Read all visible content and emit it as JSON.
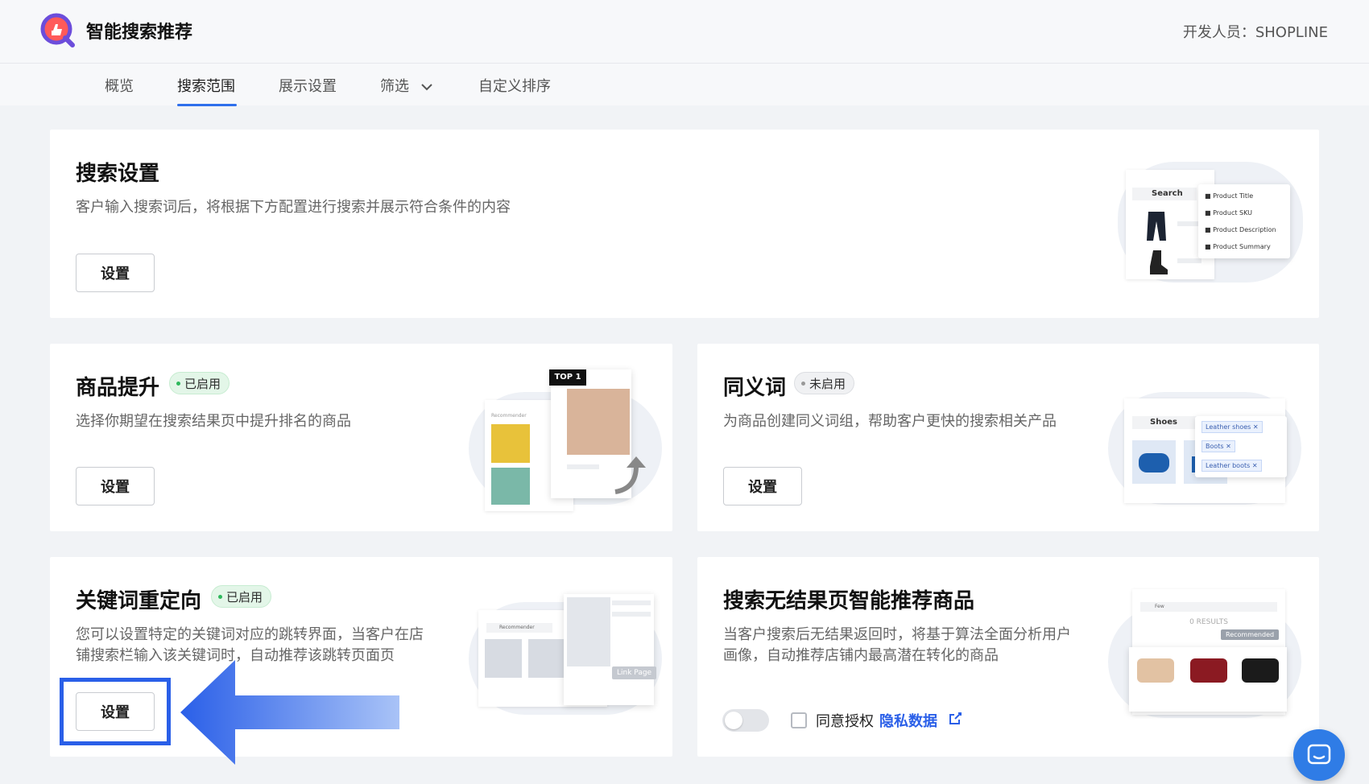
{
  "header": {
    "app_title": "智能搜索推荐",
    "developer": "开发人员：SHOPLINE"
  },
  "tabs": [
    {
      "label": "概览"
    },
    {
      "label": "搜索范围"
    },
    {
      "label": "展示设置"
    },
    {
      "label": "筛选"
    },
    {
      "label": "自定义排序"
    }
  ],
  "cards": {
    "search_settings": {
      "title": "搜索设置",
      "desc": "客户输入搜索词后，将根据下方配置进行搜索并展示符合条件的内容",
      "button": "设置",
      "illus": {
        "search": "Search",
        "options": [
          "Product Title",
          "Product SKU",
          "Product Description",
          "Product Summary"
        ]
      }
    },
    "product_boost": {
      "title": "商品提升",
      "badge": "已启用",
      "desc": "选择你期望在搜索结果页中提升排名的商品",
      "button": "设置",
      "illus": {
        "top_label": "TOP 1",
        "recommender": "Recommender"
      }
    },
    "synonyms": {
      "title": "同义词",
      "badge": "未启用",
      "desc": "为商品创建同义词组，帮助客户更快的搜索相关产品",
      "button": "设置",
      "illus": {
        "search": "Shoes",
        "tags": [
          "Leather shoes",
          "Boots",
          "Leather boots"
        ]
      }
    },
    "keyword_redirect": {
      "title": "关键词重定向",
      "badge": "已启用",
      "desc_line1": "您可以设置特定的关键词对应的跳转界面，当客户在店",
      "desc_line2": "铺搜索栏输入该关键词时，自动推荐该跳转页面页",
      "button": "设置",
      "illus": {
        "recommender": "Recommender",
        "link_page": "Link Page"
      }
    },
    "no_results": {
      "title": "搜索无结果页智能推荐商品",
      "desc_line1": "当客户搜索后无结果返回时，将基于算法全面分析用户",
      "desc_line2": "画像，自动推荐店铺内最高潜在转化的商品",
      "consent_label": "同意授权",
      "privacy_link": "隐私数据",
      "illus": {
        "search": "Few",
        "results": "0 RESULTS",
        "recommended": "Recommended"
      }
    }
  },
  "colors": {
    "accent": "#2a5fe8",
    "enabled": "#2eb85c"
  }
}
